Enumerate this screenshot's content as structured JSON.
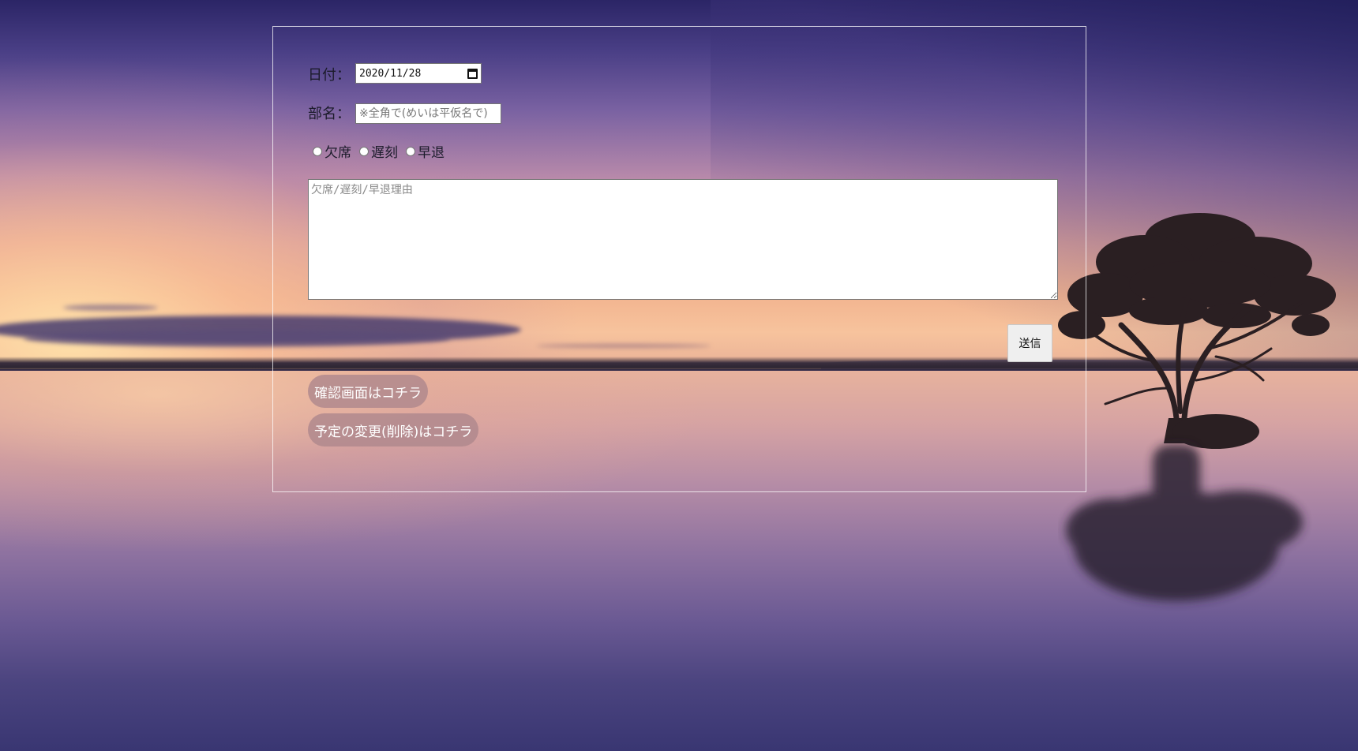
{
  "form": {
    "date_label": "日付：",
    "date_value": "2020/11/28",
    "dept_label": "部名：",
    "dept_placeholder": "※全角で(めいは平仮名で)",
    "dept_value": "",
    "attendance_options": [
      {
        "label": "欠席",
        "selected": false
      },
      {
        "label": "遅刻",
        "selected": false
      },
      {
        "label": "早退",
        "selected": false
      }
    ],
    "reason_placeholder": "欠席/遅刻/早退理由",
    "reason_value": "",
    "submit_label": "送信"
  },
  "links": {
    "confirm_label": "確認画面はコチラ",
    "change_label": "予定の変更(削除)はコチラ"
  },
  "icons": {
    "date_picker": "calendar-icon",
    "textarea_resize": "resize-grip-icon"
  },
  "colors": {
    "pill_background": "#af878c",
    "panel_border": "#ffffff",
    "label_text": "#1b1b2a"
  }
}
